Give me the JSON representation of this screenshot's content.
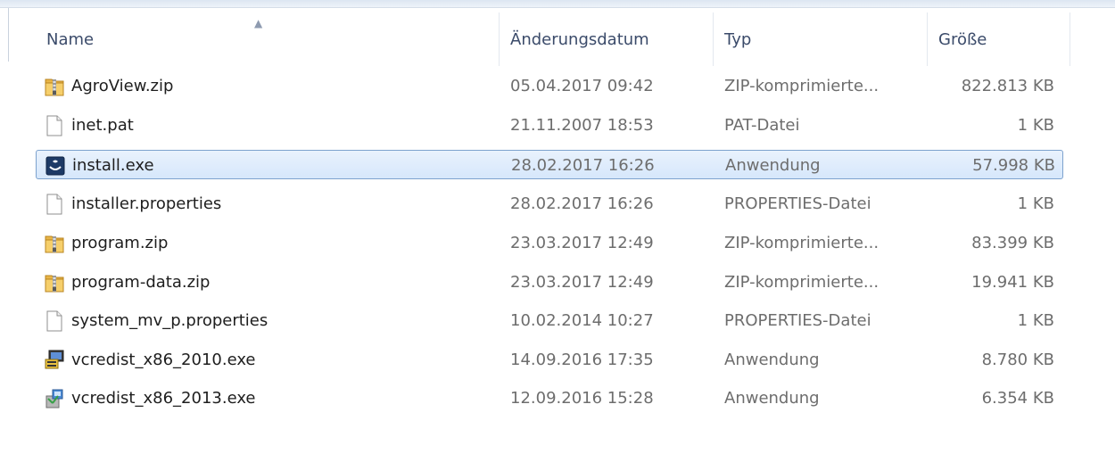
{
  "columns": {
    "name": "Name",
    "date": "Änderungsdatum",
    "type": "Typ",
    "size": "Größe"
  },
  "files": [
    {
      "name": "AgroView.zip",
      "date": "05.04.2017 09:42",
      "type": "ZIP-komprimierte...",
      "size": "822.813 KB",
      "icon": "zip-folder-icon",
      "selected": false
    },
    {
      "name": "inet.pat",
      "date": "21.11.2007 18:53",
      "type": "PAT-Datei",
      "size": "1 KB",
      "icon": "blank-file-icon",
      "selected": false
    },
    {
      "name": "install.exe",
      "date": "28.02.2017 16:26",
      "type": "Anwendung",
      "size": "57.998 KB",
      "icon": "installer-app-icon",
      "selected": true
    },
    {
      "name": "installer.properties",
      "date": "28.02.2017 16:26",
      "type": "PROPERTIES-Datei",
      "size": "1 KB",
      "icon": "blank-file-icon",
      "selected": false
    },
    {
      "name": "program.zip",
      "date": "23.03.2017 12:49",
      "type": "ZIP-komprimierte...",
      "size": "83.399 KB",
      "icon": "zip-folder-icon",
      "selected": false
    },
    {
      "name": "program-data.zip",
      "date": "23.03.2017 12:49",
      "type": "ZIP-komprimierte...",
      "size": "19.941 KB",
      "icon": "zip-folder-icon",
      "selected": false
    },
    {
      "name": "system_mv_p.properties",
      "date": "10.02.2014 10:27",
      "type": "PROPERTIES-Datei",
      "size": "1 KB",
      "icon": "blank-file-icon",
      "selected": false
    },
    {
      "name": "vcredist_x86_2010.exe",
      "date": "14.09.2016 17:35",
      "type": "Anwendung",
      "size": "8.780 KB",
      "icon": "setup-computer-icon",
      "selected": false
    },
    {
      "name": "vcredist_x86_2013.exe",
      "date": "12.09.2016 15:28",
      "type": "Anwendung",
      "size": "6.354 KB",
      "icon": "setup-package-icon",
      "selected": false
    }
  ],
  "colors": {
    "header_text": "#3b4b6a",
    "selection_border": "#7da2ce",
    "selection_fill": "#d6e7fb"
  }
}
